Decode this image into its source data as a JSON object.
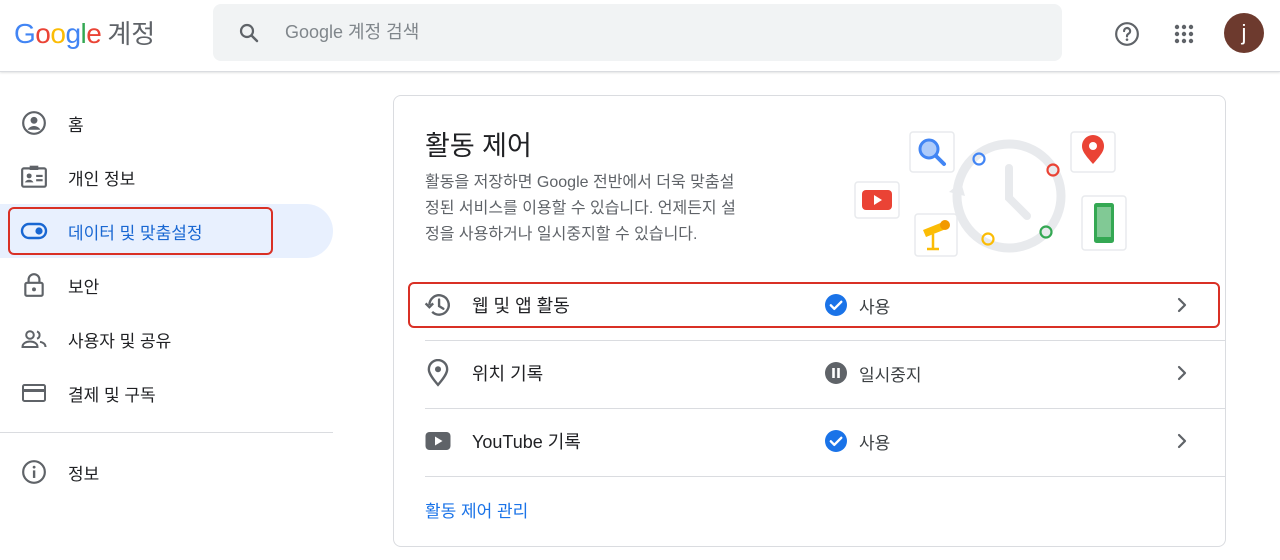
{
  "header": {
    "logo_letters": [
      "G",
      "o",
      "o",
      "g",
      "l",
      "e"
    ],
    "product": "계정",
    "search_placeholder": "Google 계정 검색",
    "avatar_initial": "j"
  },
  "sidebar": {
    "items": [
      {
        "label": "홈",
        "icon": "account-circle-icon",
        "active": false
      },
      {
        "label": "개인 정보",
        "icon": "id-card-icon",
        "active": false
      },
      {
        "label": "데이터 및 맞춤설정",
        "icon": "toggle-icon",
        "active": true
      },
      {
        "label": "보안",
        "icon": "lock-icon",
        "active": false
      },
      {
        "label": "사용자 및 공유",
        "icon": "people-icon",
        "active": false
      },
      {
        "label": "결제 및 구독",
        "icon": "credit-card-icon",
        "active": false
      }
    ],
    "footer_items": [
      {
        "label": "정보",
        "icon": "info-icon"
      }
    ]
  },
  "card": {
    "title": "활동 제어",
    "description_lines": [
      "활동을 저장하면 Google 전반에서 더욱 맞춤설",
      "정된 서비스를 이용할 수 있습니다. 언제든지 설",
      "정을 사용하거나 일시중지할 수 있습니다."
    ],
    "rows": [
      {
        "label": "웹 및 앱 활동",
        "status": "사용",
        "icon": "history-icon",
        "status_icon": "check-circle-icon"
      },
      {
        "label": "위치 기록",
        "status": "일시중지",
        "icon": "location-pin-icon",
        "status_icon": "pause-circle-icon"
      },
      {
        "label": "YouTube 기록",
        "status": "사용",
        "icon": "youtube-icon",
        "status_icon": "check-circle-icon"
      }
    ],
    "manage_link": "활동 제어 관리"
  },
  "colors": {
    "accent": "#1a73e8",
    "active_bg": "#e8f0fe",
    "highlight": "#d93025",
    "paused": "#5f6368"
  }
}
